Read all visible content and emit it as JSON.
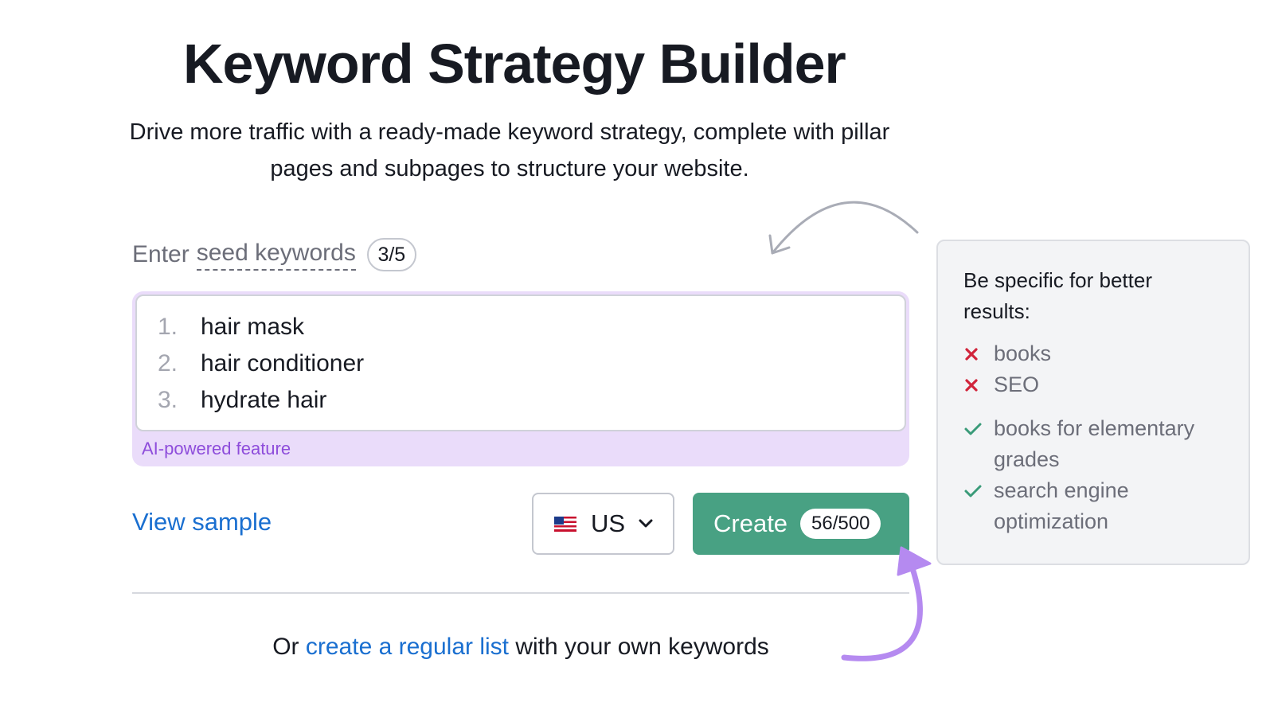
{
  "header": {
    "title": "Keyword Strategy Builder",
    "subtitle": "Drive more traffic with a ready-made keyword strategy, complete with pillar pages and subpages to structure your website."
  },
  "seed_input": {
    "label_prefix": "Enter",
    "label_underlined": "seed keywords",
    "counter": "3/5",
    "keywords": [
      {
        "num": "1.",
        "text": "hair mask"
      },
      {
        "num": "2.",
        "text": "hair conditioner"
      },
      {
        "num": "3.",
        "text": "hydrate hair"
      }
    ],
    "ai_note": "AI-powered feature"
  },
  "actions": {
    "view_sample": "View sample",
    "country": {
      "value": "US",
      "flag_icon": "us-flag-icon"
    },
    "create_label": "Create",
    "create_badge": "56/500"
  },
  "footer": {
    "prefix": "Or ",
    "link": "create a regular list",
    "suffix": " with your own keywords"
  },
  "tips": {
    "title": "Be specific for better results:",
    "bad_examples": [
      "books",
      "SEO"
    ],
    "good_examples": [
      "books for elementary grades",
      "search engine optimization"
    ]
  },
  "colors": {
    "brand_green": "#48a183",
    "link_blue": "#1a6fd0",
    "ai_purple_bg": "#eadcfa",
    "ai_purple_text": "#8e4ddb",
    "bad_red": "#d1243b",
    "good_green": "#3a9b79",
    "arrow_purple": "#b58af0",
    "arrow_gray": "#a9acb6"
  }
}
